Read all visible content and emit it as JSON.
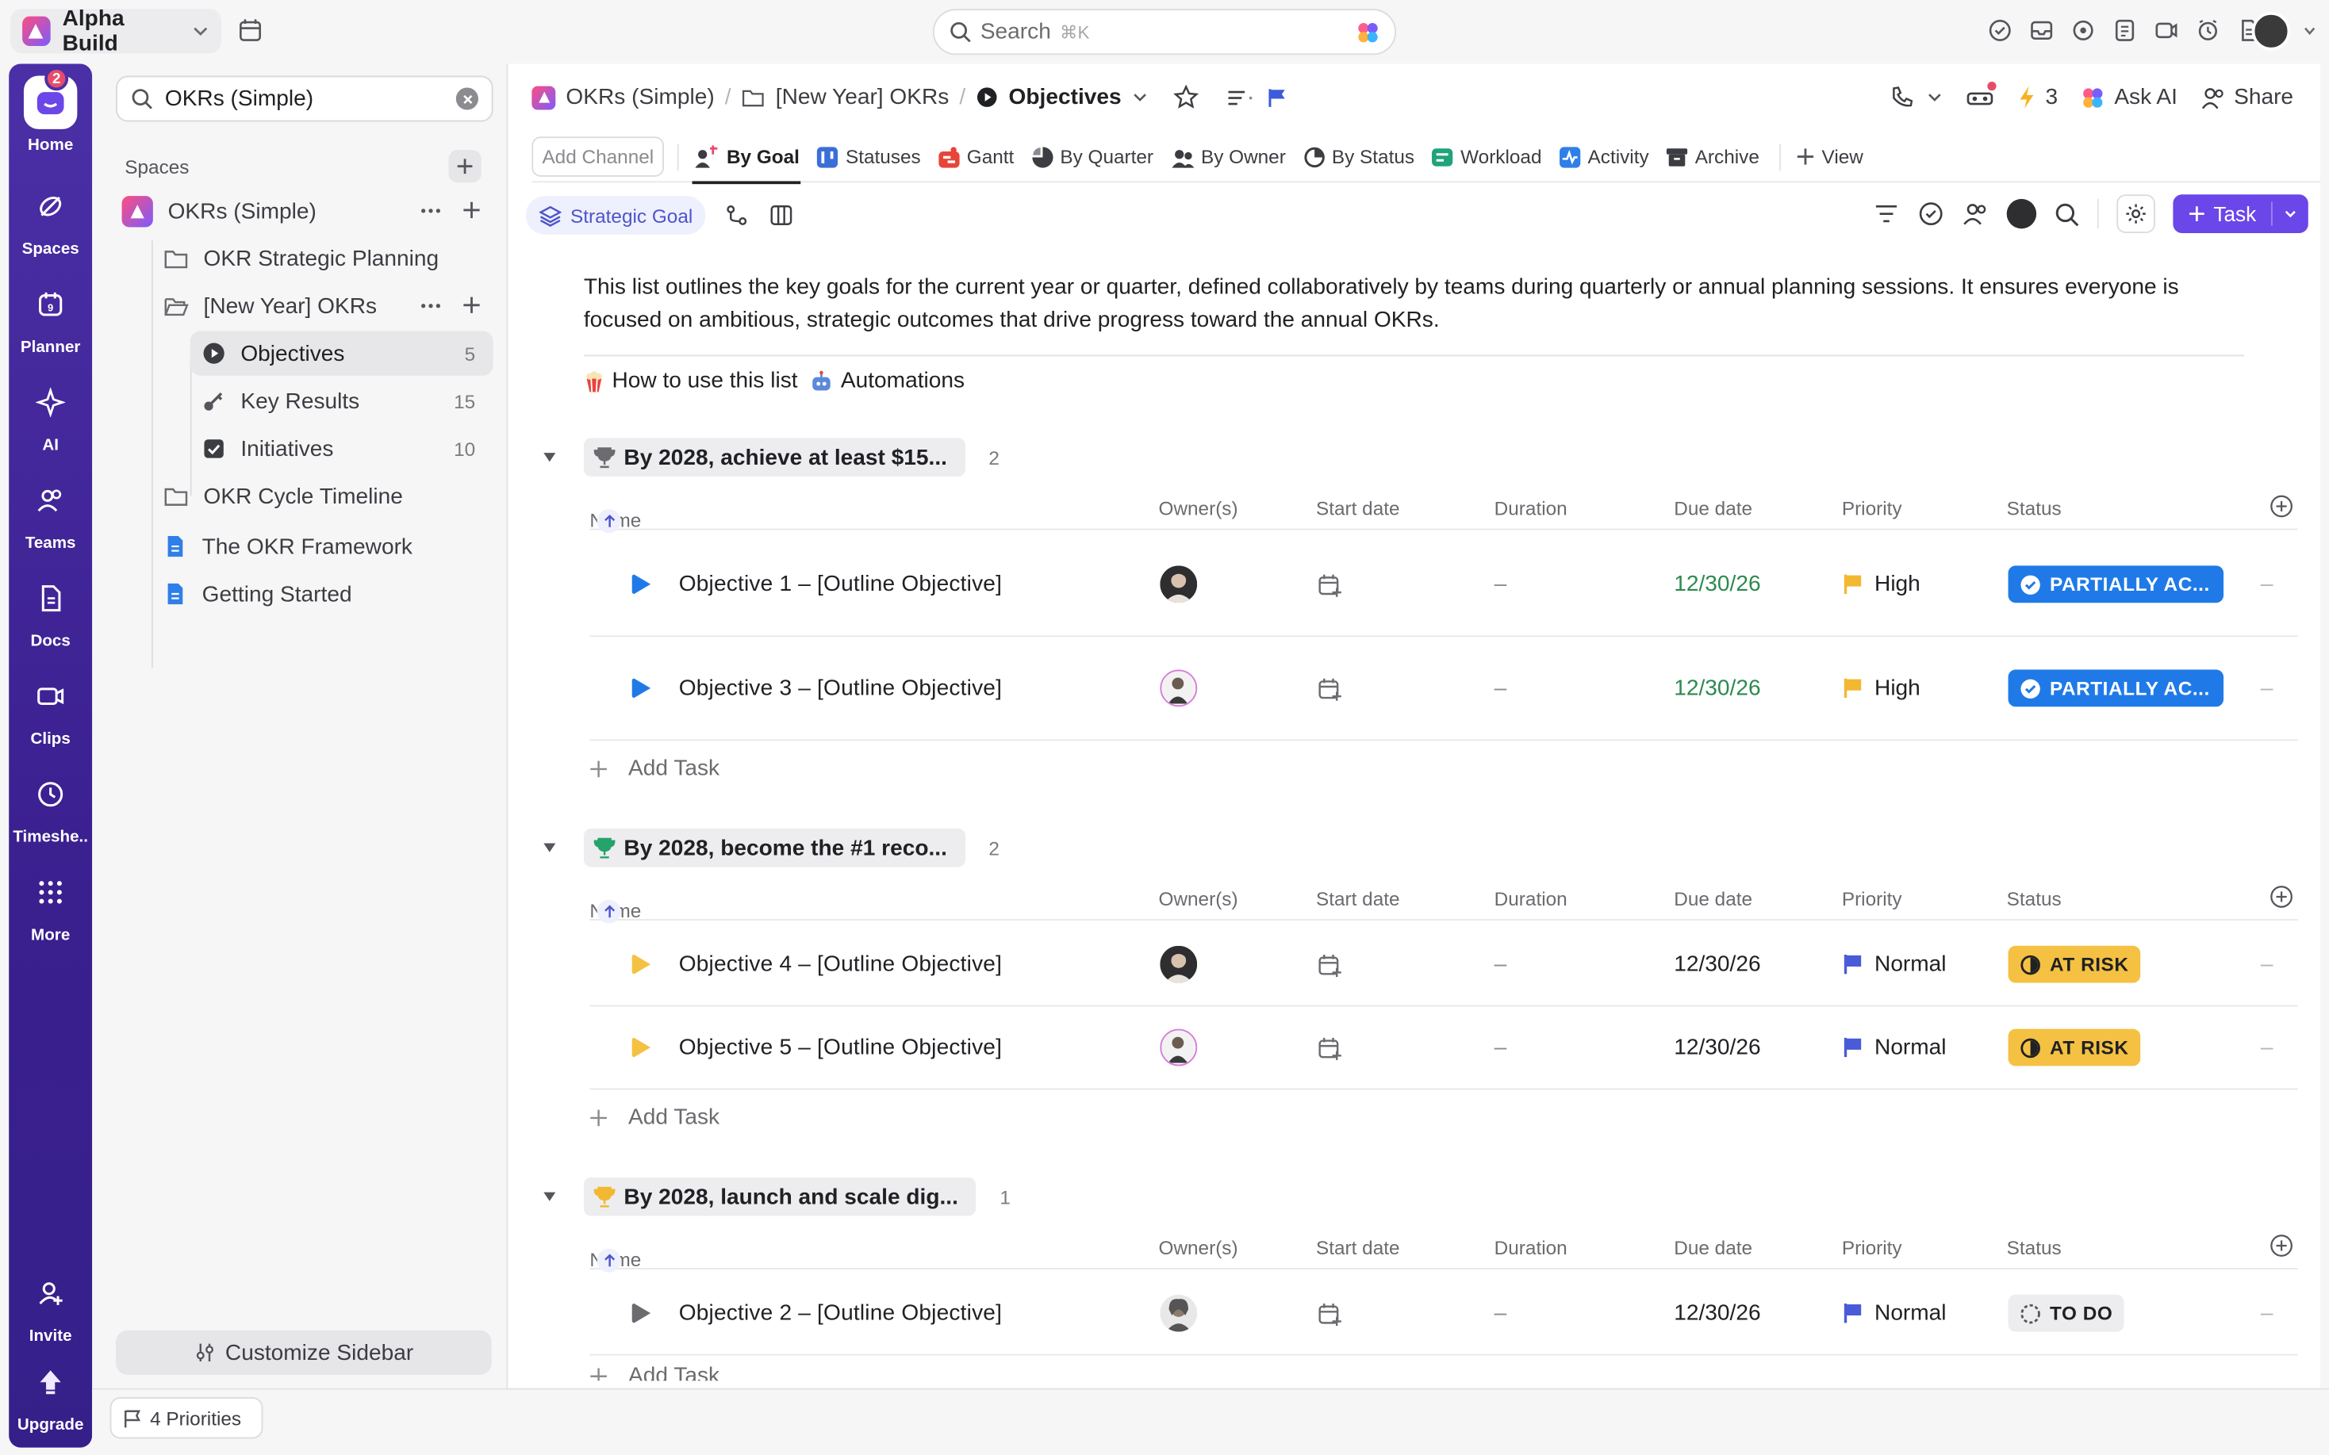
{
  "workspace": {
    "name": "Alpha Build"
  },
  "search": {
    "placeholder": "Search",
    "shortcut": "⌘K"
  },
  "rail": {
    "home_badge": "2",
    "items": [
      {
        "label": "Home",
        "icon": "home-icon"
      },
      {
        "label": "Spaces",
        "icon": "spaces-icon"
      },
      {
        "label": "Planner",
        "icon": "planner-icon"
      },
      {
        "label": "AI",
        "icon": "ai-icon"
      },
      {
        "label": "Teams",
        "icon": "teams-icon"
      },
      {
        "label": "Docs",
        "icon": "docs-icon"
      },
      {
        "label": "Clips",
        "icon": "clips-icon"
      },
      {
        "label": "Timeshe..",
        "icon": "timesheet-icon"
      },
      {
        "label": "More",
        "icon": "more-grid-icon"
      }
    ],
    "invite": "Invite",
    "upgrade": "Upgrade"
  },
  "sidebar": {
    "search_value": "OKRs (Simple)",
    "spaces_label": "Spaces",
    "space": "OKRs (Simple)",
    "items": [
      {
        "label": "OKR Strategic Planning",
        "icon": "folder-icon"
      },
      {
        "label": "[New Year] OKRs",
        "icon": "folder-open-icon"
      },
      {
        "label": "Objectives",
        "count": "5",
        "icon": "list-objectives-icon"
      },
      {
        "label": "Key Results",
        "count": "15",
        "icon": "key-icon"
      },
      {
        "label": "Initiatives",
        "count": "10",
        "icon": "checkbox-icon"
      },
      {
        "label": "OKR Cycle Timeline",
        "icon": "folder-icon"
      },
      {
        "label": "The OKR Framework",
        "icon": "doc-icon"
      },
      {
        "label": "Getting Started",
        "icon": "doc-icon"
      }
    ],
    "customize": "Customize Sidebar",
    "priorities": "4 Priorities"
  },
  "header": {
    "crumbs": [
      "OKRs (Simple)",
      "[New Year] OKRs",
      "Objectives"
    ],
    "ai_count": "3",
    "ask_ai": "Ask AI",
    "share": "Share"
  },
  "tabs": {
    "add_channel": "Add Channel",
    "views": [
      "By Goal",
      "Statuses",
      "Gantt",
      "By Quarter",
      "By Owner",
      "By Status",
      "Workload",
      "Activity",
      "Archive"
    ],
    "add_view": "View",
    "active": "By Goal"
  },
  "toolbar": {
    "filter_chip": "Strategic Goal",
    "task_button": "Task"
  },
  "description": "This list outlines the key goals for the current year or quarter, defined collaboratively by teams during quarterly or annual planning sessions. It ensures everyone is focused on ambitious, strategic outcomes that drive progress toward the annual OKRs.",
  "links": {
    "how_to": "How to use this list",
    "automations": "Automations"
  },
  "columns": {
    "name": "Name",
    "owners": "Owner(s)",
    "start": "Start date",
    "duration": "Duration",
    "due": "Due date",
    "priority": "Priority",
    "status": "Status"
  },
  "add_task": "Add Task",
  "groups": [
    {
      "title": "By 2028, achieve at least $15...",
      "count": "2",
      "trophy_color": "#6b6b70",
      "rows": [
        {
          "name": "Objective 1 – [Outline Objective]",
          "duration": "–",
          "due": "12/30/26",
          "priority": "High",
          "status": "PARTIALLY AC...",
          "flag": "#f2b830",
          "play": "#1f7ae8"
        },
        {
          "name": "Objective 3 – [Outline Objective]",
          "duration": "–",
          "due": "12/30/26",
          "priority": "High",
          "status": "PARTIALLY AC...",
          "flag": "#f2b830",
          "play": "#1f7ae8"
        }
      ]
    },
    {
      "title": "By 2028, become the #1 reco...",
      "count": "2",
      "trophy_color": "#25a36b",
      "rows": [
        {
          "name": "Objective 4 – [Outline Objective]",
          "duration": "–",
          "due": "12/30/26",
          "priority": "Normal",
          "status": "AT RISK",
          "flag": "#4a5bd8",
          "play": "#f5c142"
        },
        {
          "name": "Objective 5 – [Outline Objective]",
          "duration": "–",
          "due": "12/30/26",
          "priority": "Normal",
          "status": "AT RISK",
          "flag": "#4a5bd8",
          "play": "#f5c142"
        }
      ]
    },
    {
      "title": "By 2028, launch and scale dig...",
      "count": "1",
      "trophy_color": "#f2b830",
      "rows": [
        {
          "name": "Objective 2 – [Outline Objective]",
          "duration": "–",
          "due": "12/30/26",
          "priority": "Normal",
          "status": "TO DO",
          "flag": "#4a5bd8",
          "play": "#6b6b70"
        }
      ]
    }
  ],
  "colors": {
    "accent": "#6b46e8",
    "rail": "#4b2fa6",
    "partial": "#1f7ae8",
    "risk": "#f5c142",
    "due_green": "#2c8a4e"
  }
}
